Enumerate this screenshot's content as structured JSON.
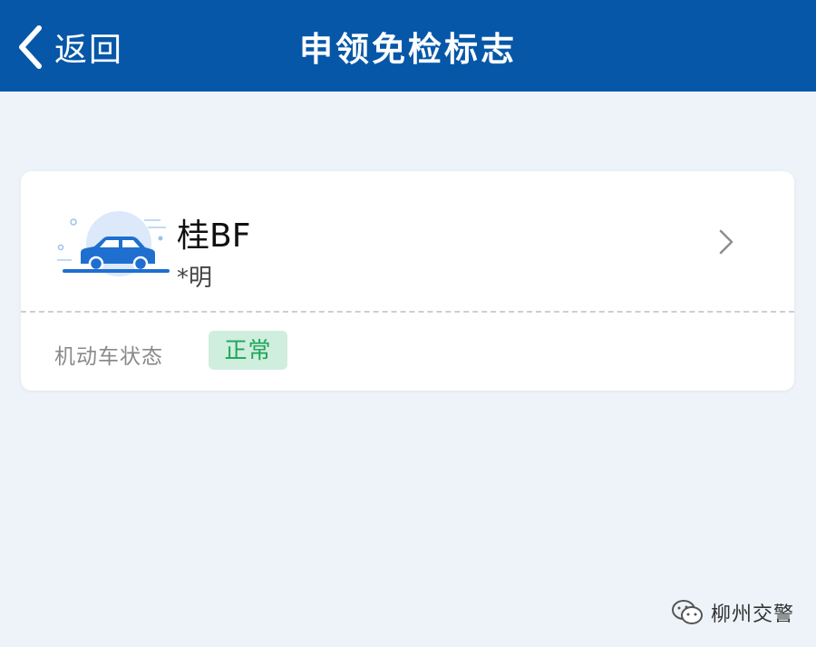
{
  "header": {
    "back_label": "返回",
    "title": "申领免检标志"
  },
  "vehicle": {
    "plate": "桂BF",
    "owner": "*明",
    "status_label": "机动车状态",
    "status_value": "正常"
  },
  "watermark": {
    "text": "柳州交警"
  },
  "colors": {
    "header_bg": "#0657a8",
    "page_bg": "#edf3f8",
    "status_badge_bg": "#cfeedd",
    "status_badge_text": "#1ea55a",
    "car_blue": "#1e6fd0"
  },
  "icons": {
    "back": "chevron-left-icon",
    "row_arrow": "chevron-right-icon",
    "vehicle": "car-icon",
    "watermark": "wechat-icon"
  }
}
